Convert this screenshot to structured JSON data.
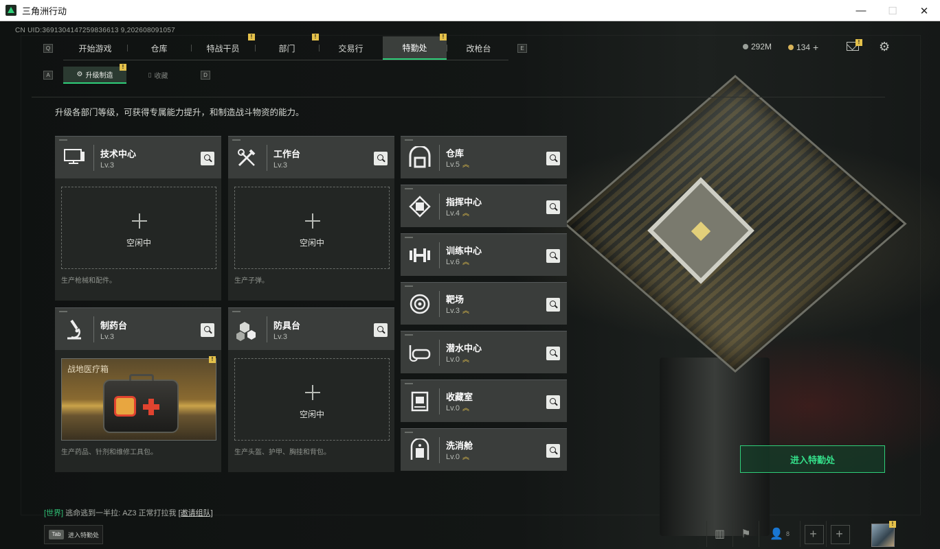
{
  "window": {
    "title": "三角洲行动",
    "minimize": "—",
    "maximize": "☐",
    "close": "✕"
  },
  "uid": "CN UID:3691304147259836613 9,202608091057",
  "nav": {
    "left_key": "Q",
    "right_key": "E",
    "tabs": [
      {
        "label": "开始游戏",
        "badge": ""
      },
      {
        "label": "仓库",
        "badge": ""
      },
      {
        "label": "特战干员",
        "badge": "!"
      },
      {
        "label": "部门",
        "badge": "!"
      },
      {
        "label": "交易行",
        "badge": ""
      },
      {
        "label": "特勤处",
        "badge": "!",
        "active": true
      },
      {
        "label": "改枪台",
        "badge": ""
      }
    ]
  },
  "currency": {
    "silver": "292M",
    "gold": "134",
    "gold_add": "+"
  },
  "subtabs": {
    "left_key": "A",
    "right_key": "D",
    "items": [
      {
        "label": "升级制造",
        "badge": "!",
        "active": true
      },
      {
        "label": "收藏",
        "badge": ""
      }
    ]
  },
  "description": "升级各部门等级，可获得专属能力提升，和制造战斗物资的能力。",
  "workshops": [
    {
      "name": "技术中心",
      "level": "Lv.3",
      "icon": "computer-icon",
      "slot": "空闲中",
      "desc": "生产枪械和配件。"
    },
    {
      "name": "工作台",
      "level": "Lv.3",
      "icon": "tools-icon",
      "slot": "空闲中",
      "desc": "生产子弹。"
    },
    {
      "name": "制药台",
      "level": "Lv.3",
      "icon": "microscope-icon",
      "slot_item": "战地医疗箱",
      "slot_badge": "!",
      "desc": "生产药品、针剂和维修工具包。"
    },
    {
      "name": "防具台",
      "level": "Lv.3",
      "icon": "cubes-icon",
      "slot": "空闲中",
      "desc": "生产头盔、护甲、胸挂和背包。"
    }
  ],
  "departments": [
    {
      "name": "仓库",
      "level": "Lv.5",
      "icon": "warehouse-icon"
    },
    {
      "name": "指挥中心",
      "level": "Lv.4",
      "icon": "command-icon"
    },
    {
      "name": "训练中心",
      "level": "Lv.6",
      "icon": "dumbbell-icon"
    },
    {
      "name": "靶场",
      "level": "Lv.3",
      "icon": "target-icon"
    },
    {
      "name": "潜水中心",
      "level": "Lv.0",
      "icon": "diving-mask-icon"
    },
    {
      "name": "收藏室",
      "level": "Lv.0",
      "icon": "collection-icon"
    },
    {
      "name": "洗消舱",
      "level": "Lv.0",
      "icon": "decon-icon"
    }
  ],
  "enter_button": "进入特勤处",
  "chat": {
    "channel": "[世界]",
    "message": "逃命逃到一半拉: AZ3 正常打拉我",
    "link": "[邀请组队]"
  },
  "tab_hint": {
    "key": "Tab",
    "label": "进入特勤处"
  },
  "bottom": {
    "friends_count": "8",
    "avatar_badge": "!"
  },
  "colors": {
    "accent": "#2fd07a",
    "badge": "#e4c14a",
    "panel": "#3a3d3b"
  }
}
